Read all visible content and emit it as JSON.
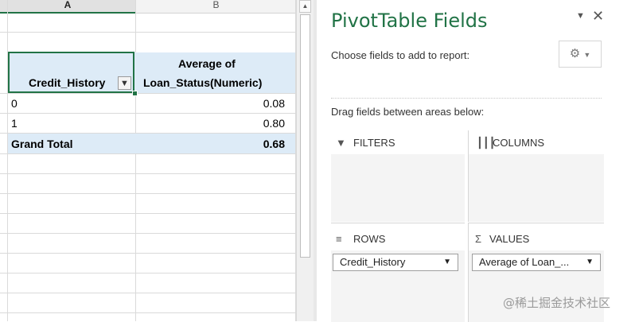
{
  "sheet": {
    "columns": [
      "A",
      "B"
    ],
    "header_row_label": "Credit_History",
    "header_value_line1": "Average of",
    "header_value_line2": "Loan_Status(Numeric)",
    "rows": [
      {
        "label": "0",
        "value": "0.08"
      },
      {
        "label": "1",
        "value": "0.80"
      }
    ],
    "grand_total_label": "Grand Total",
    "grand_total_value": "0.68"
  },
  "pane": {
    "title": "PivotTable Fields",
    "choose_text": "Choose fields to add to report:",
    "drag_text": "Drag fields between areas below:",
    "filters_label": "FILTERS",
    "columns_label": "COLUMNS",
    "rows_label": "ROWS",
    "values_label": "VALUES",
    "rows_field": "Credit_History",
    "values_field": "Average of Loan_..."
  },
  "watermark": "@稀土掘金技术社区",
  "colors": {
    "accent": "#217346",
    "header_fill": "#ddebf7"
  }
}
